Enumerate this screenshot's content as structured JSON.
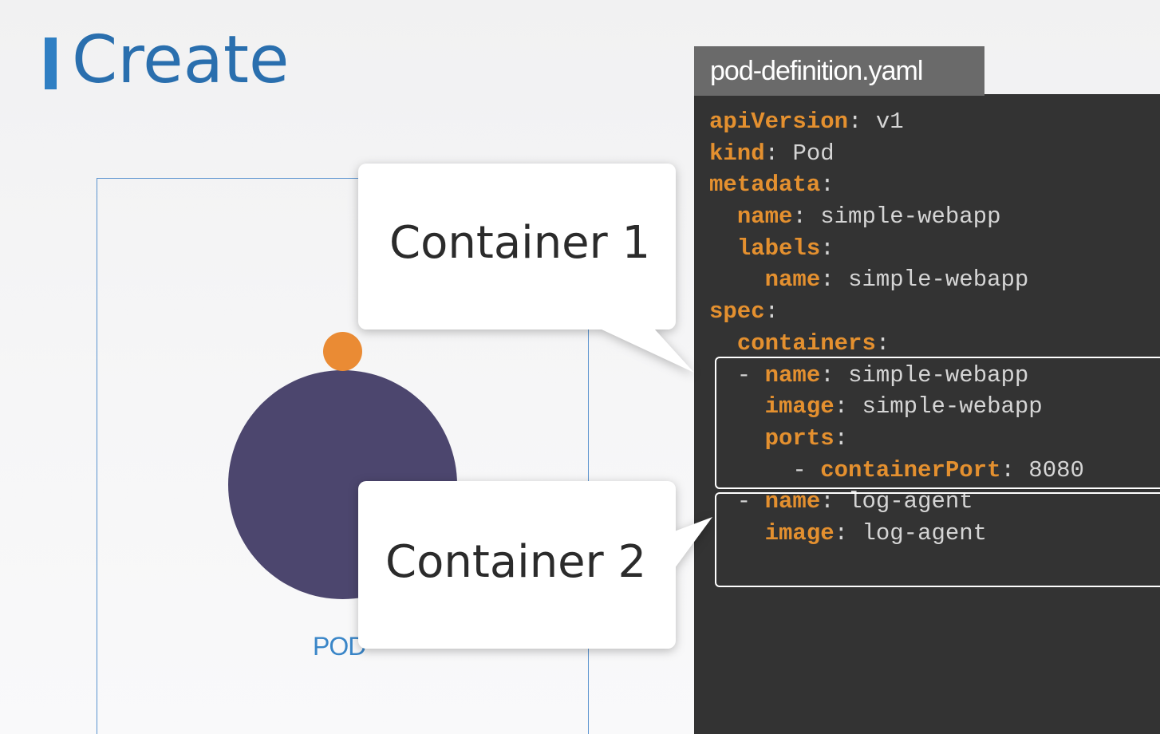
{
  "slide": {
    "title": "Create"
  },
  "pod": {
    "label": "POD"
  },
  "editor": {
    "filename": "pod-definition.yaml",
    "lines": [
      {
        "indent": "",
        "key": "apiVersion",
        "sep": ": ",
        "value": "v1"
      },
      {
        "indent": "",
        "key": "kind",
        "sep": ": ",
        "value": "Pod"
      },
      {
        "indent": "",
        "key": "metadata",
        "sep": ":",
        "value": ""
      },
      {
        "indent": "  ",
        "key": "name",
        "sep": ": ",
        "value": "simple-webapp"
      },
      {
        "indent": "  ",
        "key": "labels",
        "sep": ":",
        "value": ""
      },
      {
        "indent": "    ",
        "key": "name",
        "sep": ": ",
        "value": "simple-webapp"
      },
      {
        "indent": "",
        "key": "spec",
        "sep": ":",
        "value": ""
      },
      {
        "indent": "  ",
        "key": "containers",
        "sep": ":",
        "value": ""
      },
      {
        "indent": "  - ",
        "key": "name",
        "sep": ": ",
        "value": "simple-webapp"
      },
      {
        "indent": "    ",
        "key": "image",
        "sep": ": ",
        "value": "simple-webapp"
      },
      {
        "indent": "    ",
        "key": "ports",
        "sep": ":",
        "value": ""
      },
      {
        "indent": "      - ",
        "key": "containerPort",
        "sep": ": ",
        "value": "8080"
      },
      {
        "indent": "  - ",
        "key": "name",
        "sep": ": ",
        "value": "log-agent"
      },
      {
        "indent": "    ",
        "key": "image",
        "sep": ": ",
        "value": "log-agent"
      }
    ]
  },
  "callouts": {
    "container1": "Container 1",
    "container2": "Container 2"
  },
  "colors": {
    "title_blue": "#2a6fae",
    "pod_purple": "#4c466e",
    "pod_orange": "#ea8b34",
    "yaml_key": "#e4902f",
    "editor_bg": "#333333"
  }
}
